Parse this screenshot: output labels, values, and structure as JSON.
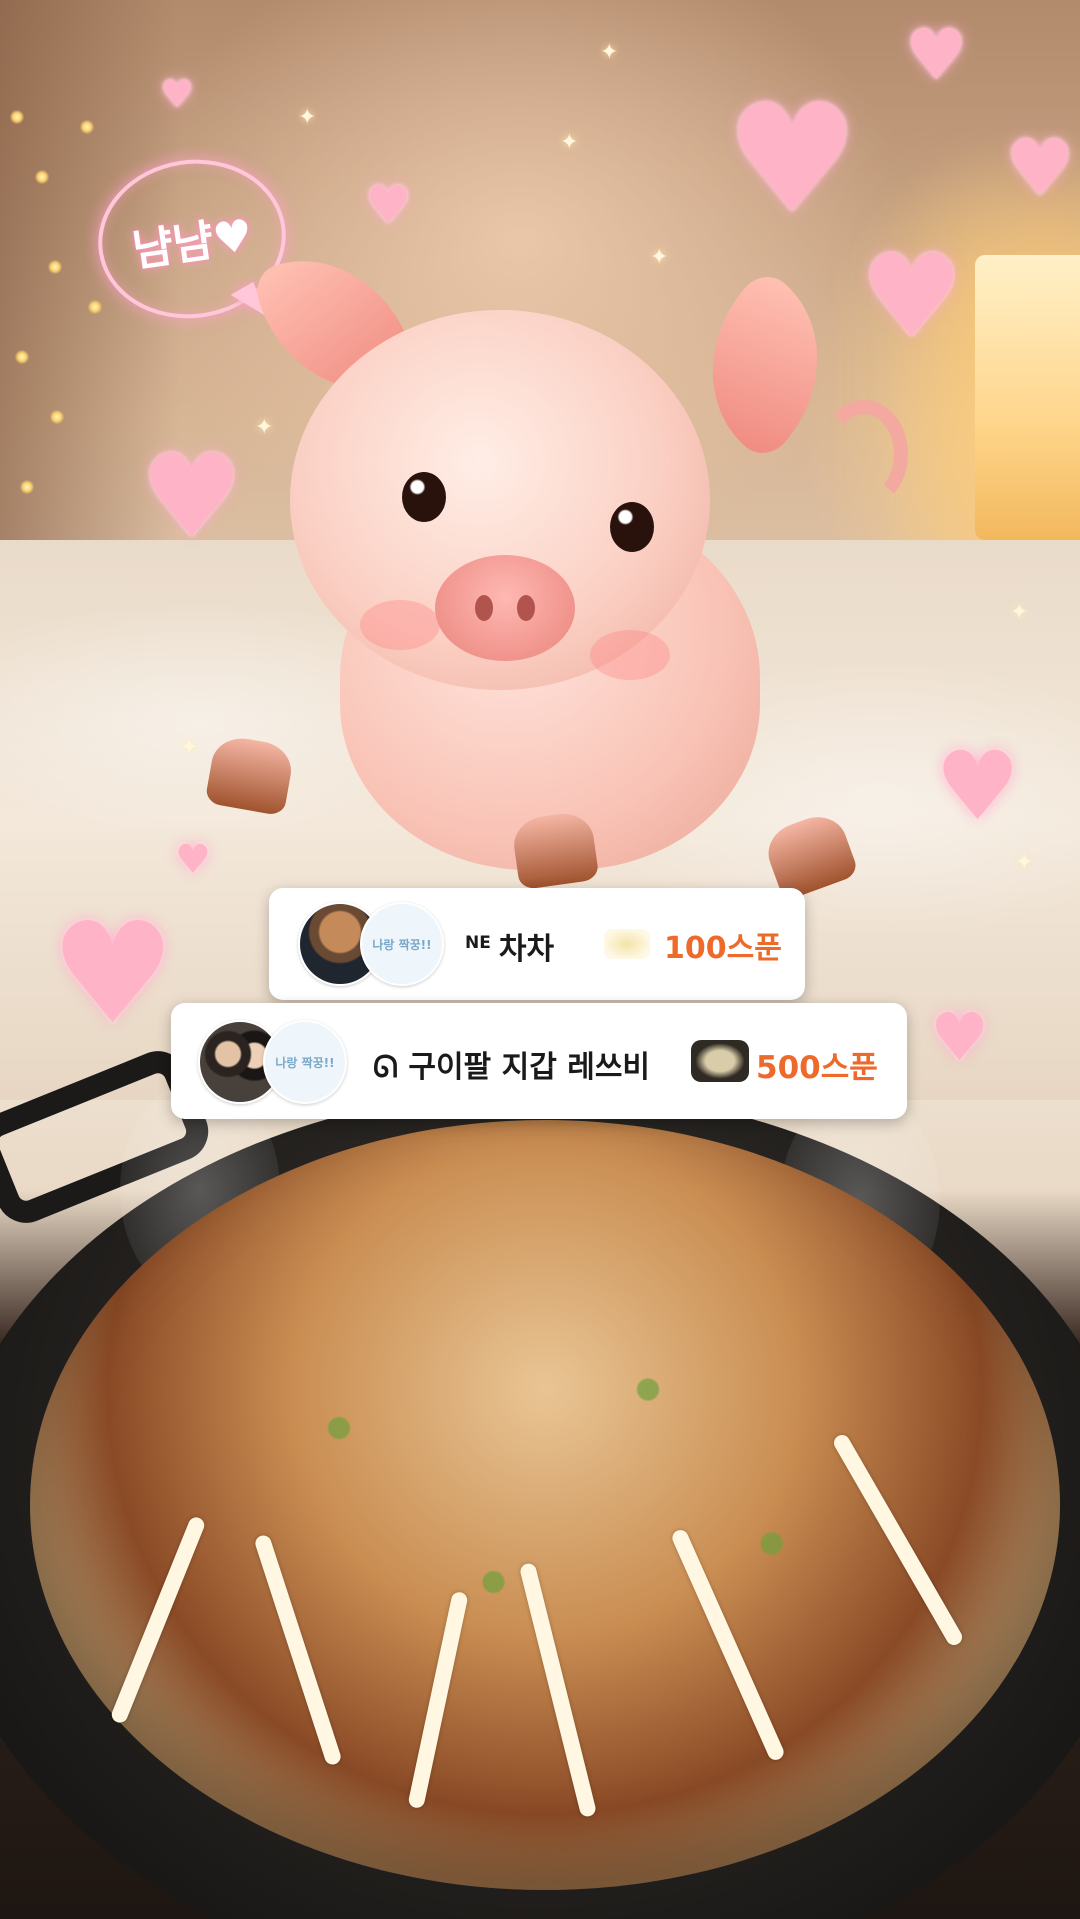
{
  "overlay": {
    "speech_bubble": "냠냠♥"
  },
  "donations": [
    {
      "badge": "NE",
      "name": "차차",
      "amount": "100스푼",
      "avatar_badge_text": "나랑 짝꿍!!",
      "gift_icon": "sticker-icon"
    },
    {
      "badge": "",
      "name": "ᘏ 구이팔 지갑 레쓰비",
      "amount": "500스푼",
      "avatar_badge_text": "나랑 짝꿍!!",
      "gift_icon": "okonomiyaki-icon"
    }
  ],
  "colors": {
    "amount": "#ee6a2a",
    "card_bg": "#ffffff",
    "heart_glow": "#ffb3c6"
  }
}
